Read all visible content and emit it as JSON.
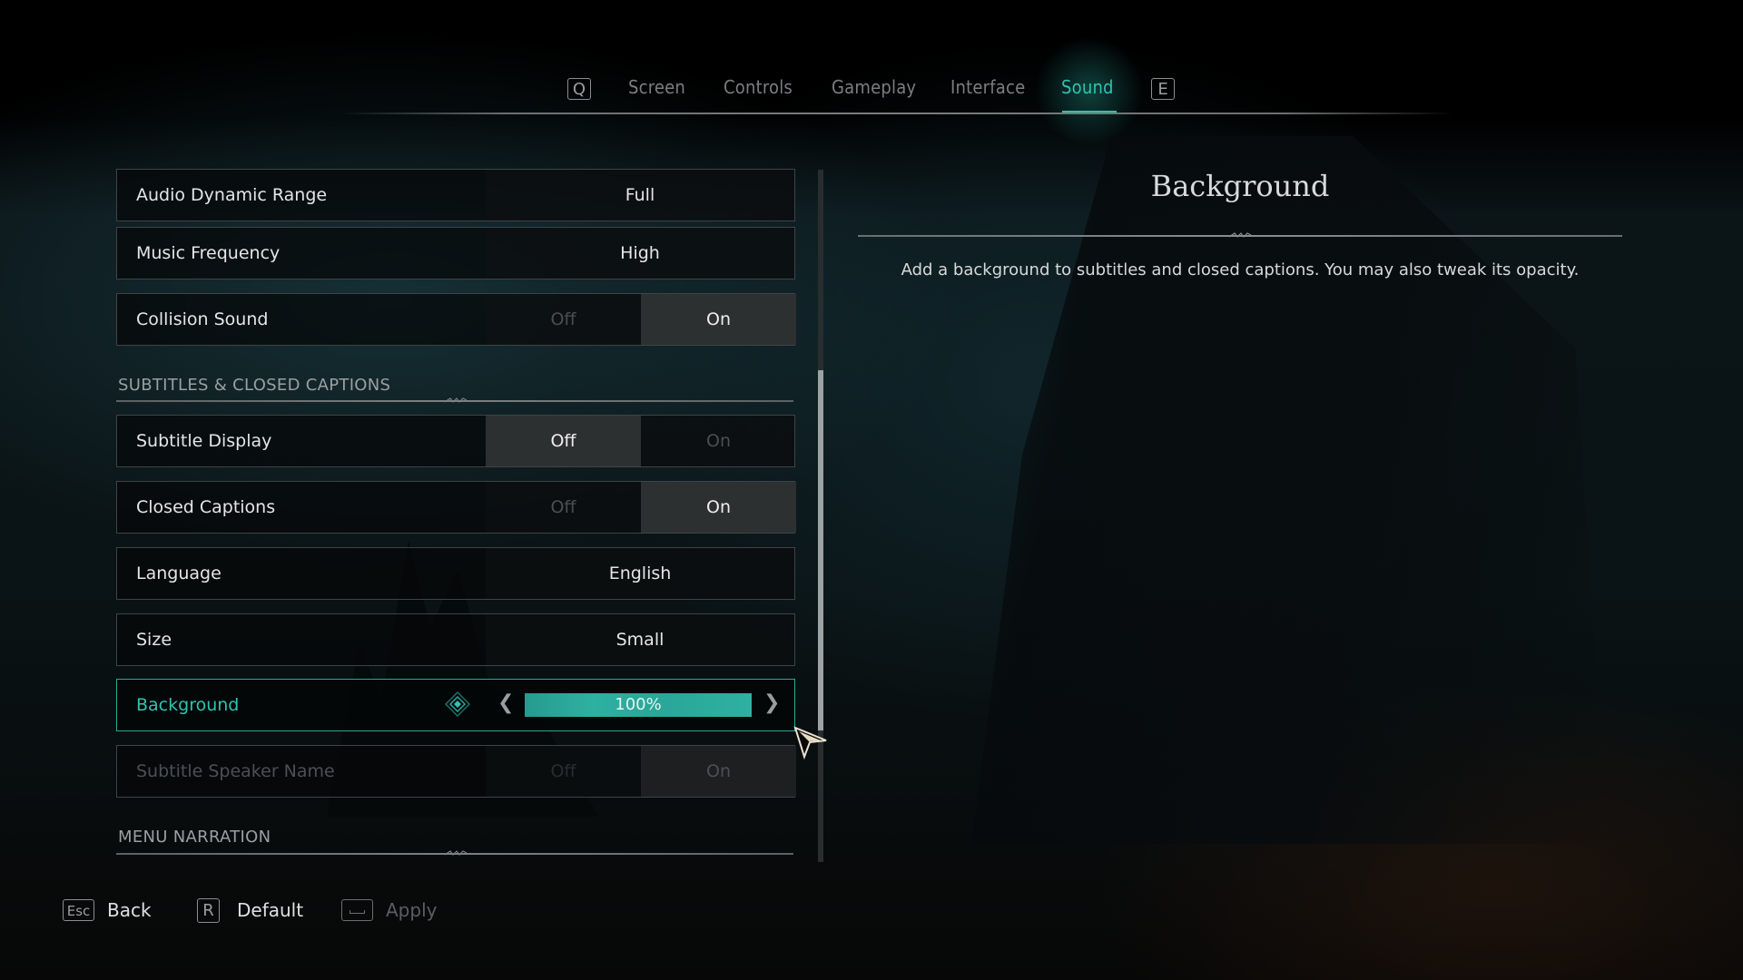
{
  "tabs": {
    "prev_key": "Q",
    "next_key": "E",
    "items": [
      {
        "label": "Screen",
        "active": false
      },
      {
        "label": "Controls",
        "active": false
      },
      {
        "label": "Gameplay",
        "active": false
      },
      {
        "label": "Interface",
        "active": false
      },
      {
        "label": "Sound",
        "active": true
      }
    ]
  },
  "settings": {
    "rows": [
      {
        "label": "Audio Dynamic Range",
        "type": "select",
        "value": "Full"
      },
      {
        "label": "Music Frequency",
        "type": "select",
        "value": "High"
      },
      {
        "label": "Collision Sound",
        "type": "toggle",
        "off_label": "Off",
        "on_label": "On",
        "value": "On"
      }
    ],
    "section_subtitles": "SUBTITLES & CLOSED CAPTIONS",
    "subtitle_rows": [
      {
        "label": "Subtitle Display",
        "type": "toggle",
        "off_label": "Off",
        "on_label": "On",
        "value": "Off"
      },
      {
        "label": "Closed Captions",
        "type": "toggle",
        "off_label": "Off",
        "on_label": "On",
        "value": "On"
      },
      {
        "label": "Language",
        "type": "select",
        "value": "English"
      },
      {
        "label": "Size",
        "type": "select",
        "value": "Small"
      },
      {
        "label": "Background",
        "type": "slider",
        "value": "100%",
        "fraction": 1.0,
        "selected": true
      },
      {
        "label": "Subtitle Speaker Name",
        "type": "toggle",
        "off_label": "Off",
        "on_label": "On",
        "value": "On",
        "disabled": true
      }
    ],
    "section_narration": "MENU NARRATION"
  },
  "scrollbar": {
    "position_fraction": 0.29,
    "visible_fraction": 0.52
  },
  "detail": {
    "title": "Background",
    "description": "Add a background to subtitles and closed captions. You may also tweak its opacity."
  },
  "footer": {
    "back": {
      "key": "Esc",
      "label": "Back"
    },
    "default": {
      "key": "R",
      "label": "Default"
    },
    "apply": {
      "key": "space-bar-icon",
      "label": "Apply",
      "enabled": false
    }
  },
  "colors": {
    "accent": "#2fc3b0",
    "slider": "#2aa99b",
    "text": "#e4e6e6",
    "muted": "#7a7e80"
  }
}
